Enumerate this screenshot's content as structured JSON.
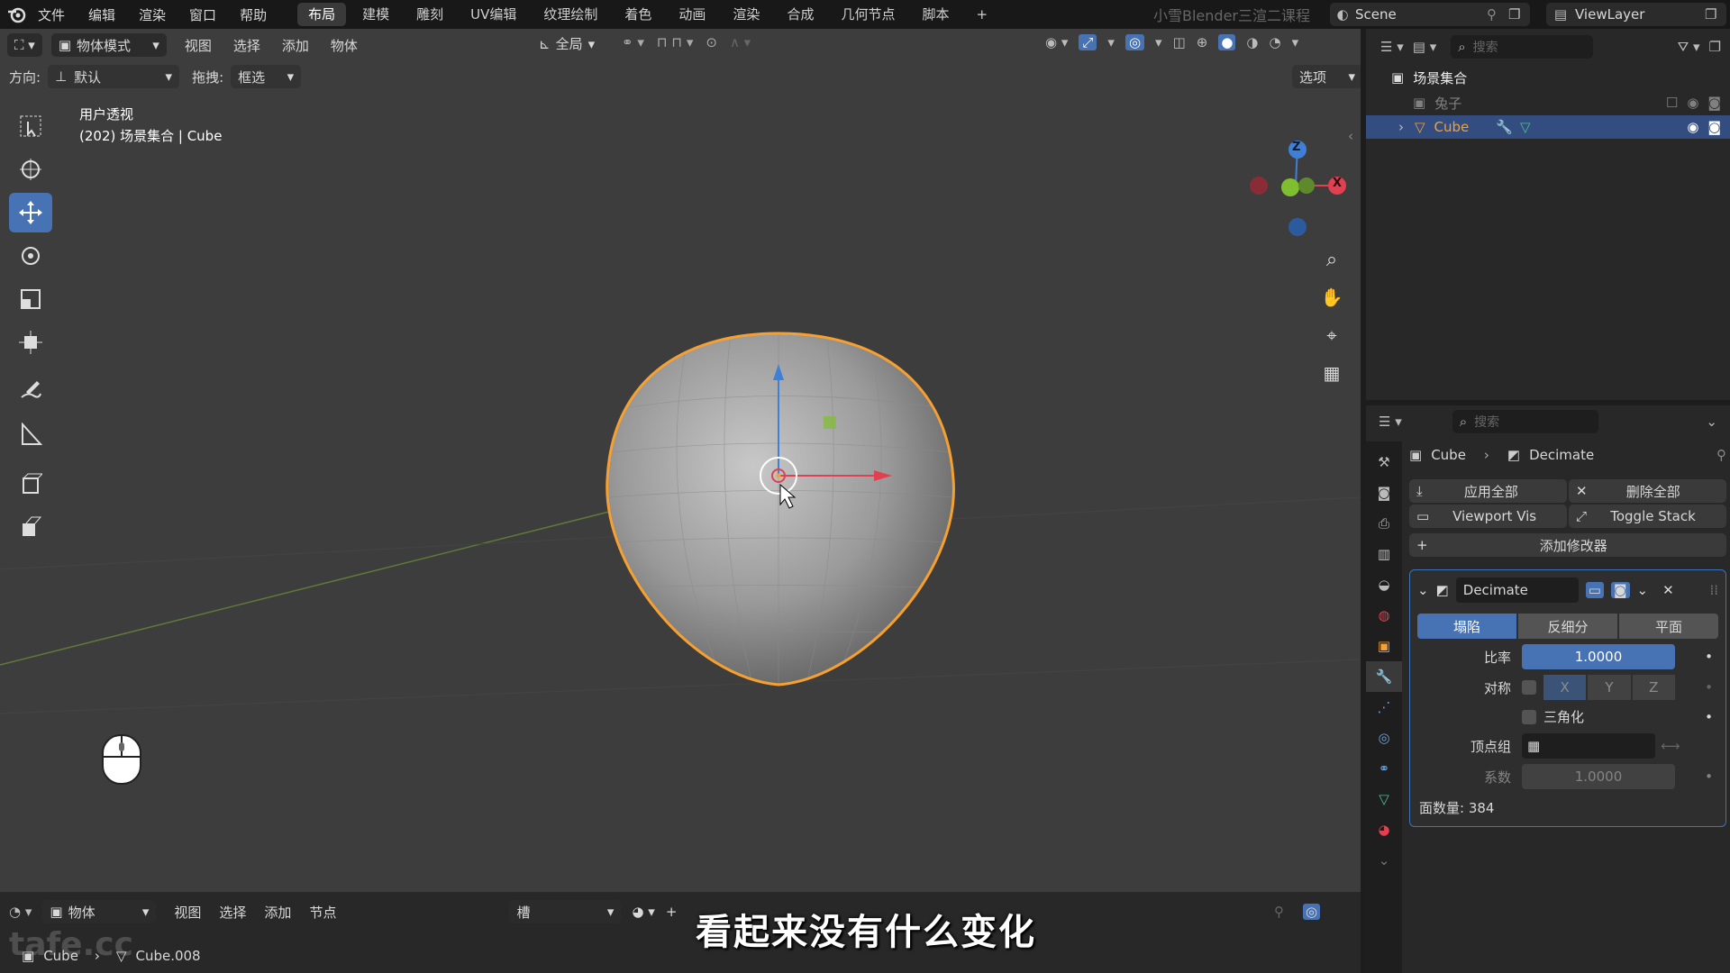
{
  "topbar": {
    "menus": [
      "文件",
      "编辑",
      "渲染",
      "窗口",
      "帮助"
    ],
    "workspaces": [
      "布局",
      "建模",
      "雕刻",
      "UV编辑",
      "纹理绘制",
      "着色",
      "动画",
      "渲染",
      "合成",
      "几何节点",
      "脚本"
    ],
    "active_workspace": "布局",
    "watermark": "小雪Blender三渲二课程",
    "scene": "Scene",
    "view_layer": "ViewLayer"
  },
  "viewport": {
    "mode": "物体模式",
    "menus": [
      "视图",
      "选择",
      "添加",
      "物体"
    ],
    "transform_orient": "全局",
    "orientation_label": "方向:",
    "orientation_value": "默认",
    "drag_label": "拖拽:",
    "drag_value": "框选",
    "options": "选项",
    "overlay_title": "用户透视",
    "overlay_sub": "(202) 场景集合 | Cube",
    "gizmo": {
      "z": "Z",
      "x": "X"
    }
  },
  "outliner": {
    "search_placeholder": "搜索",
    "scene_collection": "场景集合",
    "items": [
      {
        "name": "兔子"
      },
      {
        "name": "Cube"
      }
    ]
  },
  "properties": {
    "search_placeholder": "搜索",
    "breadcrumb_object": "Cube",
    "breadcrumb_modifier": "Decimate",
    "apply_all": "应用全部",
    "delete_all": "删除全部",
    "viewport_vis": "Viewport Vis",
    "toggle_stack": "Toggle Stack",
    "add_modifier": "添加修改器",
    "modifier": {
      "name": "Decimate",
      "modes": [
        "塌陷",
        "反细分",
        "平面"
      ],
      "active_mode": "塌陷",
      "ratio_label": "比率",
      "ratio_value": "1.0000",
      "symmetry_label": "对称",
      "axes": [
        "X",
        "Y",
        "Z"
      ],
      "triangulate_label": "三角化",
      "vertex_group_label": "顶点组",
      "factor_label": "系数",
      "factor_value": "1.0000",
      "face_count": "面数量: 384"
    }
  },
  "bottom": {
    "mode": "物体",
    "menus": [
      "视图",
      "选择",
      "添加",
      "节点"
    ],
    "slot": "槽",
    "breadcrumb_object": "Cube",
    "breadcrumb_mesh": "Cube.008",
    "subtitle": "看起来没有什么变化",
    "logo_text": "tafe.cc"
  },
  "colors": {
    "accent": "#4772b3",
    "selection_outline": "#f5a030",
    "axis_x": "#e0404f",
    "axis_y": "#7fbf2f",
    "axis_z": "#3f7fd6"
  }
}
